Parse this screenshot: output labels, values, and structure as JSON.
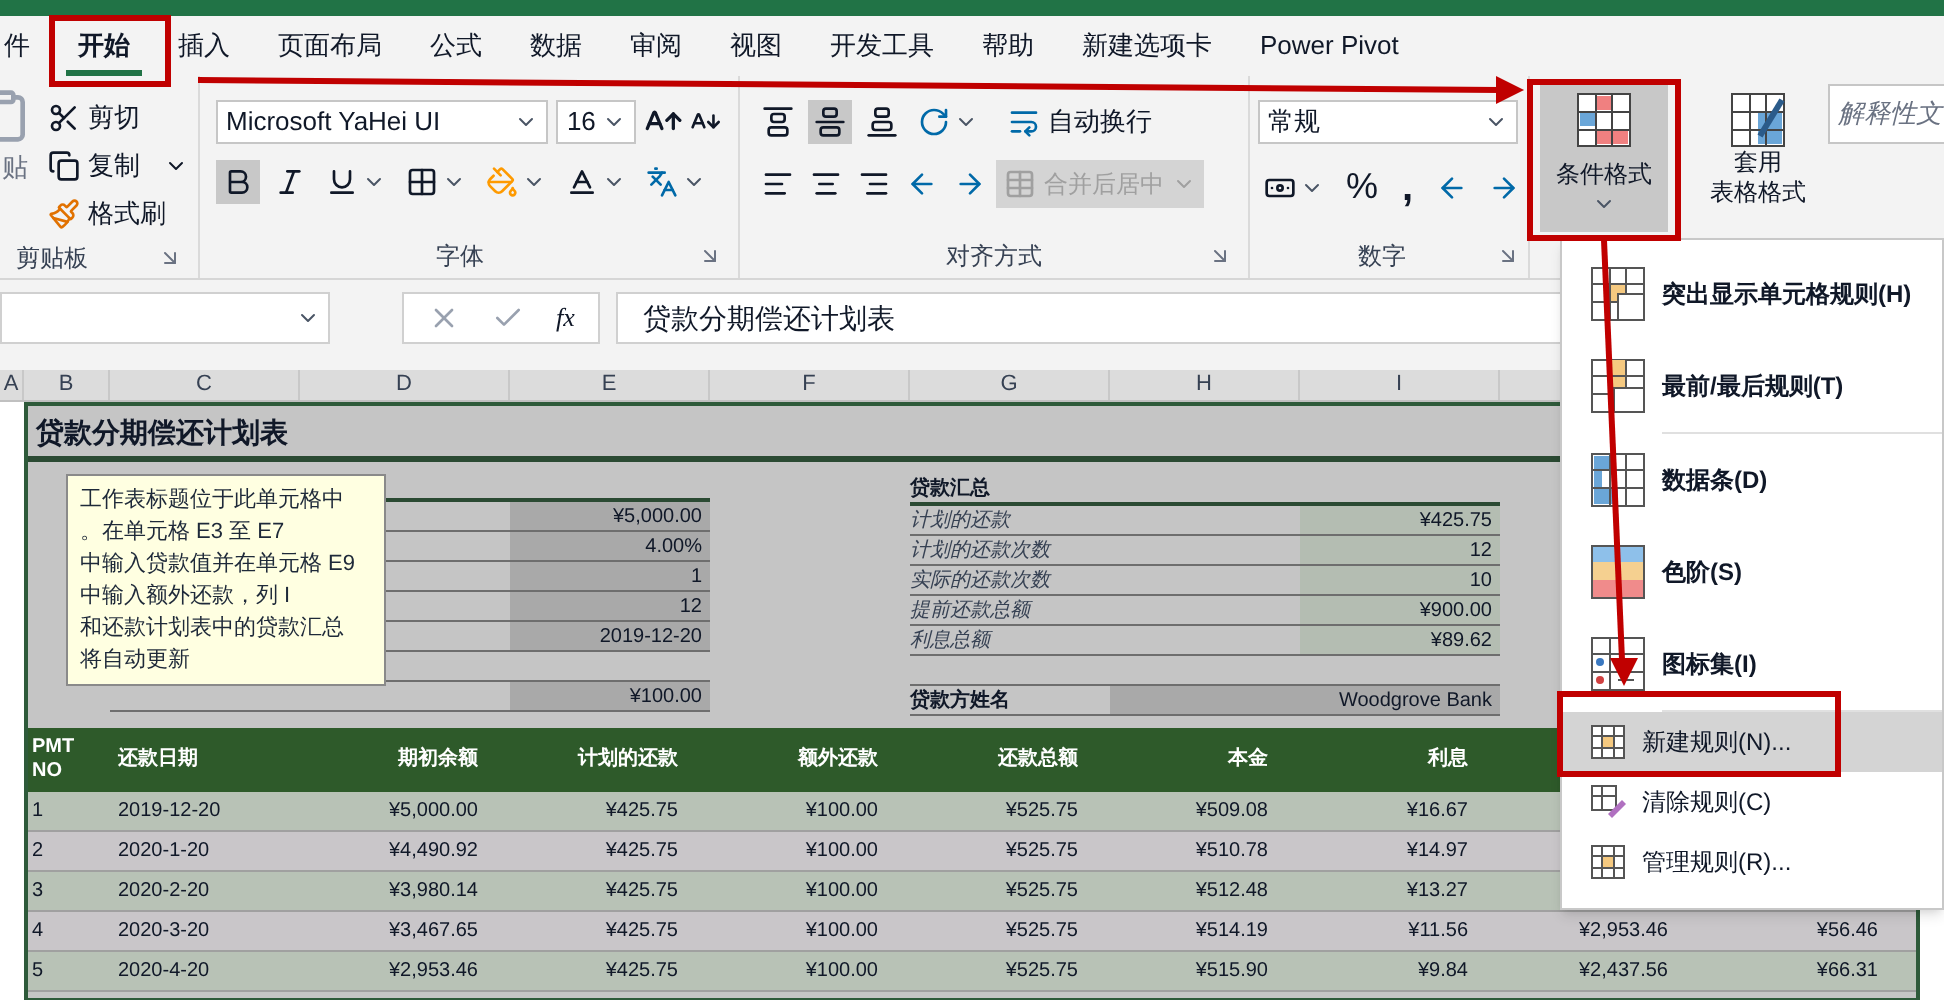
{
  "tabs": [
    {
      "label": "件",
      "selected": false
    },
    {
      "label": "开始",
      "selected": true
    },
    {
      "label": "插入",
      "selected": false
    },
    {
      "label": "页面布局",
      "selected": false
    },
    {
      "label": "公式",
      "selected": false
    },
    {
      "label": "数据",
      "selected": false
    },
    {
      "label": "审阅",
      "selected": false
    },
    {
      "label": "视图",
      "selected": false
    },
    {
      "label": "开发工具",
      "selected": false
    },
    {
      "label": "帮助",
      "selected": false
    },
    {
      "label": "新建选项卡",
      "selected": false
    },
    {
      "label": "Power Pivot",
      "selected": false
    }
  ],
  "ribbon": {
    "clipboard": {
      "paste_label": "贴",
      "cut": "剪切",
      "copy": "复制",
      "format_painter": "格式刷",
      "group_label": "剪贴板"
    },
    "font": {
      "font_name": "Microsoft YaHei UI",
      "font_size": "16",
      "bold_on": true,
      "group_label": "字体"
    },
    "alignment": {
      "middle_align_on": true,
      "wrap_text": "自动换行",
      "merge_center": "合并后居中",
      "merge_disabled": true,
      "group_label": "对齐方式"
    },
    "number": {
      "format": "常规",
      "percent": "%",
      "comma": ",",
      "group_label": "数字"
    },
    "styles": {
      "conditional_formatting": "条件格式",
      "conditional_pressed": true,
      "format_as_table": [
        "套用",
        "表格格式"
      ],
      "cell_style": "解释性文"
    }
  },
  "formula_bar": {
    "function_symbol": "fx",
    "content": "贷款分期偿还计划表"
  },
  "column_headers": [
    "A",
    "B",
    "C",
    "D",
    "E",
    "F",
    "G",
    "H",
    "I"
  ],
  "sheet": {
    "title": "贷款分期偿还计划表",
    "tooltip_lines": [
      "工作表标题位于此单元格中",
      "。在单元格 E3 至 E7",
      "中输入贷款值并在单元格 E9",
      "中输入额外还款，列 I",
      "和还款计划表中的贷款汇总",
      "将自动更新"
    ],
    "loan_values": [
      "¥5,000.00",
      "4.00%",
      "1",
      "12",
      "2019-12-20"
    ],
    "extra_payment": "¥100.00",
    "summary": {
      "heading": "贷款汇总",
      "rows": [
        {
          "label": "计划的还款",
          "value": "¥425.75"
        },
        {
          "label": "计划的还款次数",
          "value": "12"
        },
        {
          "label": "实际的还款次数",
          "value": "10"
        },
        {
          "label": "提前还款总额",
          "value": "¥900.00"
        },
        {
          "label": "利息总额",
          "value": "¥89.62"
        }
      ],
      "lender_label": "贷款方姓名",
      "lender": "Woodgrove Bank"
    },
    "table": {
      "columns": [
        "PMT NO",
        "还款日期",
        "期初余额",
        "计划的还款",
        "额外还款",
        "还款总额",
        "本金",
        "利息"
      ],
      "rows": [
        {
          "cells": [
            "1",
            "2019-12-20",
            "¥5,000.00",
            "¥425.75",
            "¥100.00",
            "¥525.75",
            "¥509.08",
            "¥16.67"
          ]
        },
        {
          "cells": [
            "2",
            "2020-1-20",
            "¥4,490.92",
            "¥425.75",
            "¥100.00",
            "¥525.75",
            "¥510.78",
            "¥14.97"
          ]
        },
        {
          "cells": [
            "3",
            "2020-2-20",
            "¥3,980.14",
            "¥425.75",
            "¥100.00",
            "¥525.75",
            "¥512.48",
            "¥13.27"
          ]
        },
        {
          "cells": [
            "4",
            "2020-3-20",
            "¥3,467.65",
            "¥425.75",
            "¥100.00",
            "¥525.75",
            "¥514.19",
            "¥11.56",
            "¥2,953.46",
            "¥56.46"
          ]
        },
        {
          "cells": [
            "5",
            "2020-4-20",
            "¥2,953.46",
            "¥425.75",
            "¥100.00",
            "¥525.75",
            "¥515.90",
            "¥9.84",
            "¥2,437.56",
            "¥66.31"
          ]
        }
      ]
    }
  },
  "menu": {
    "sections": [
      {
        "items": [
          {
            "label": "突出显示单元格规则(H)",
            "kind": "large",
            "selected": false
          },
          {
            "label": "最前/最后规则(T)",
            "kind": "large",
            "selected": false
          }
        ]
      },
      {
        "items": [
          {
            "label": "数据条(D)",
            "kind": "large",
            "selected": false
          },
          {
            "label": "色阶(S)",
            "kind": "large",
            "selected": false
          },
          {
            "label": "图标集(I)",
            "kind": "large",
            "selected": false
          }
        ]
      },
      {
        "items": [
          {
            "label": "新建规则(N)...",
            "kind": "small",
            "selected": true
          },
          {
            "label": "清除规则(C)",
            "kind": "small",
            "selected": false
          },
          {
            "label": "管理规则(R)...",
            "kind": "small",
            "selected": false
          }
        ]
      }
    ]
  }
}
